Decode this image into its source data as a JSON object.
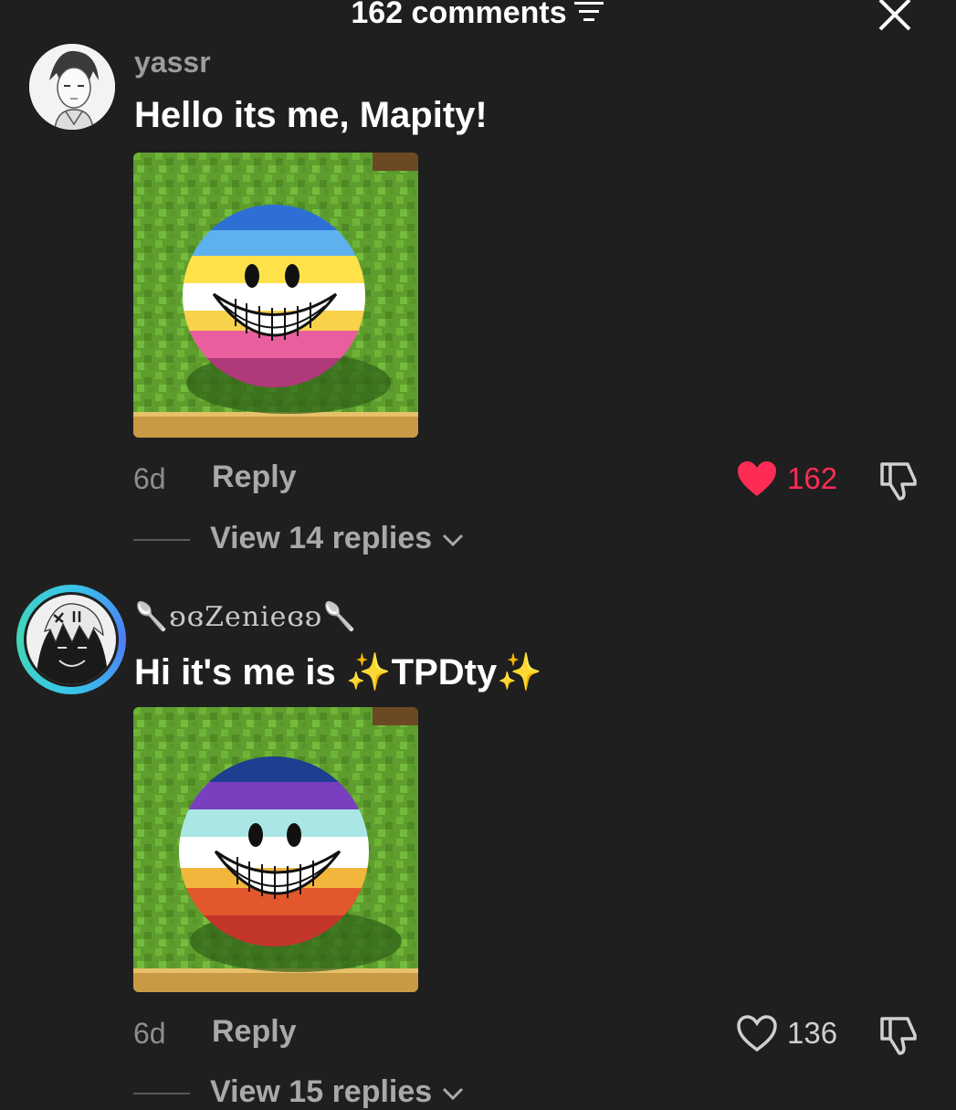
{
  "header": {
    "title": "162 comments",
    "filter_icon": "filter-icon",
    "close_icon": "close-icon"
  },
  "comments": [
    {
      "username": "yassr",
      "text": "Hello its me, Mapity!",
      "age": "6d",
      "reply_label": "Reply",
      "likes": "162",
      "liked": true,
      "view_replies": "View 14 replies",
      "ball_colors": [
        "#2e6fd6",
        "#5eb1ef",
        "#ffe14a",
        "#ffffff",
        "#f8d24a",
        "#e95f9e",
        "#b03979"
      ]
    },
    {
      "username": "🥄ʚɞZenieɞʚ🥄",
      "text_before": "Hi it's me is ",
      "sparkle": "✨",
      "text_name": "TPDty",
      "age": "6d",
      "reply_label": "Reply",
      "likes": "136",
      "liked": false,
      "view_replies": "View 15 replies",
      "ball_colors": [
        "#1e3f8f",
        "#7a3fbf",
        "#a9e6e4",
        "#ffffff",
        "#f2b63d",
        "#e2572c",
        "#c2362a"
      ]
    }
  ],
  "colors": {
    "background": "#1f1f1f",
    "like_active": "#fe2c55",
    "muted": "#8e8e8e"
  }
}
